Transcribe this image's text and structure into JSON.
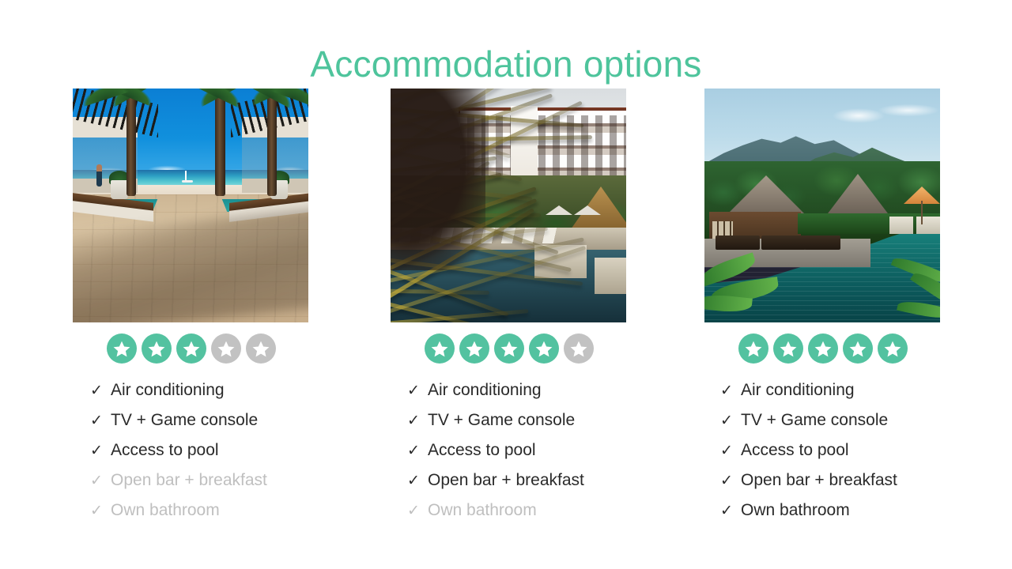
{
  "slide": {
    "title": "Accommodation options",
    "title_color": "#4EC49C",
    "background_color": "#FFFFFF"
  },
  "rating": {
    "active_color": "#53C2A0",
    "inactive_color": "#C2C2C2",
    "star_icon": "star-icon",
    "max": 5
  },
  "text_colors": {
    "included": "#2A2A2A",
    "excluded": "#BFBFBF"
  },
  "check_glyph": "✓",
  "options": [
    {
      "photo_name": "beach-deck-resort-photo",
      "photo_alt": "Beachfront resort wooden deck with pergolas, palm trees and turquoise sea",
      "stars_filled": 3,
      "features": [
        {
          "label": "Air conditioning",
          "included": true
        },
        {
          "label": "TV + Game console",
          "included": true
        },
        {
          "label": " Access to pool",
          "included": true
        },
        {
          "label": "Open bar + breakfast",
          "included": false
        },
        {
          "label": " Own bathroom",
          "included": false
        }
      ]
    },
    {
      "photo_name": "hotel-through-palms-photo",
      "photo_alt": "Resort hotel building viewed through palm fronds above a pool",
      "stars_filled": 4,
      "features": [
        {
          "label": "Air conditioning",
          "included": true
        },
        {
          "label": "TV + Game console",
          "included": true
        },
        {
          "label": " Access to pool",
          "included": true
        },
        {
          "label": "Open bar + breakfast",
          "included": true
        },
        {
          "label": " Own bathroom",
          "included": false
        }
      ]
    },
    {
      "photo_name": "tropical-bungalow-pool-photo",
      "photo_alt": "Tropical resort bungalows with thatched roofs beside a green pool and mountains",
      "stars_filled": 5,
      "features": [
        {
          "label": "Air conditioning",
          "included": true
        },
        {
          "label": "TV + Game console",
          "included": true
        },
        {
          "label": " Access to pool",
          "included": true
        },
        {
          "label": "Open bar + breakfast",
          "included": true
        },
        {
          "label": " Own bathroom",
          "included": true
        }
      ]
    }
  ]
}
